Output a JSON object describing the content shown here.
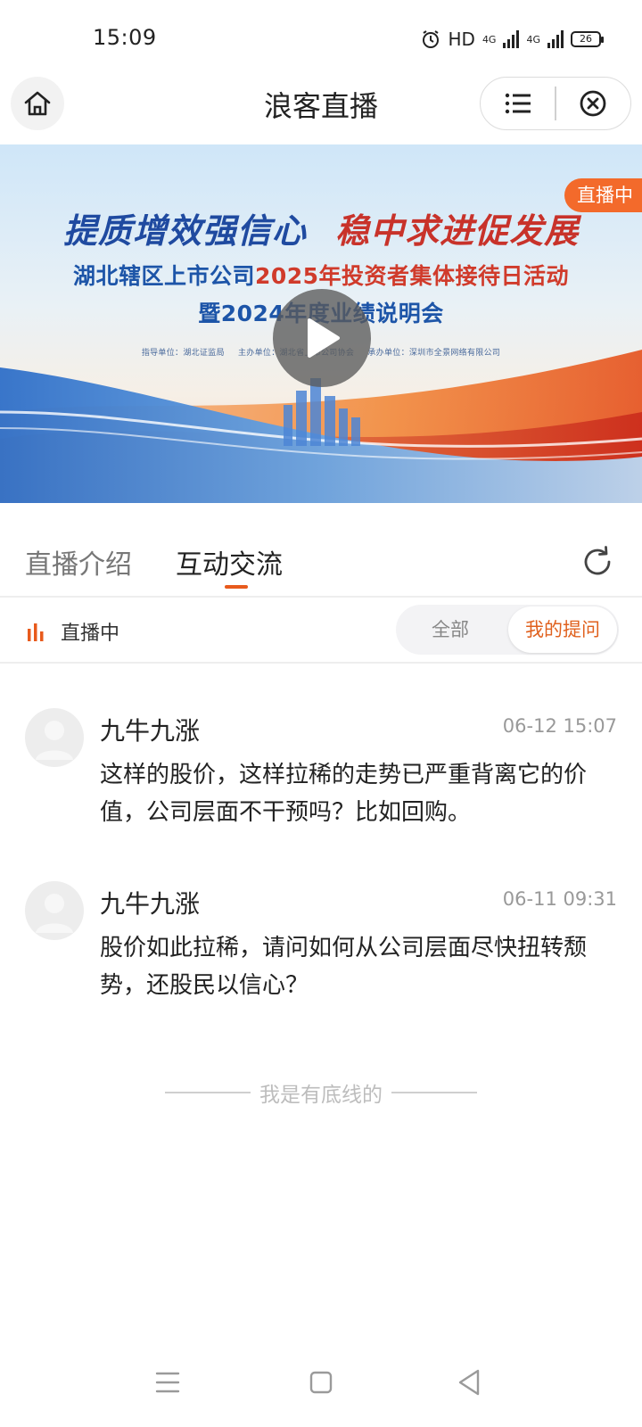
{
  "status_bar": {
    "time": "15:09",
    "hd_label": "HD",
    "net1": "4G",
    "net2": "4G",
    "battery": "26"
  },
  "header": {
    "title": "浪客直播",
    "home_icon": "home-icon",
    "menu_icon": "list-icon",
    "close_icon": "close-circle-icon"
  },
  "banner": {
    "slogan_a": "提质增效强信心",
    "slogan_b": "稳中求进促发展",
    "line1_blue": "湖北辖区上市公司",
    "line1_red": "2025年投资者集体接待日活动",
    "line2": "暨2024年度业绩说明会",
    "org1": "指导单位：湖北证监局",
    "org2": "主办单位：湖北省上市公司协会",
    "org3": "承办单位：深圳市全景网络有限公司",
    "live_tag": "直播中"
  },
  "tabs": [
    {
      "label": "直播介绍",
      "active": false
    },
    {
      "label": "互动交流",
      "active": true
    }
  ],
  "filter": {
    "live_status": "直播中",
    "seg_all": "全部",
    "seg_mine": "我的提问",
    "accent": "#e85a1c"
  },
  "comments": [
    {
      "name": "九牛九涨",
      "time": "06-12 15:07",
      "text": "这样的股价，这样拉稀的走势已严重背离它的价值，公司层面不干预吗？比如回购。"
    },
    {
      "name": "九牛九涨",
      "time": "06-11 09:31",
      "text": "股价如此拉稀，请问如何从公司层面尽快扭转颓势，还股民以信心？"
    }
  ],
  "footer_note": "我是有底线的"
}
